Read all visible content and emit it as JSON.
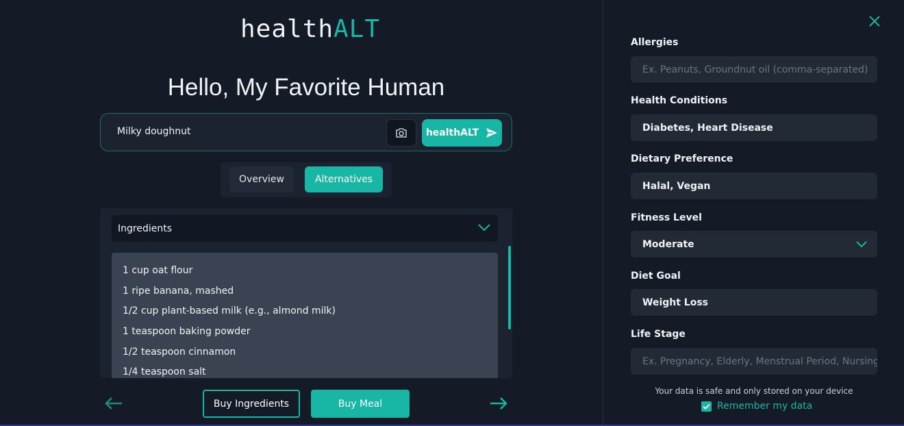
{
  "logo": {
    "prefix": "health",
    "suffix": "ALT"
  },
  "greeting": "Hello, My Favorite Human",
  "search": {
    "value": "Milky doughnut",
    "submit_label": "healthALT"
  },
  "tabs": [
    {
      "label": "Overview",
      "active": false
    },
    {
      "label": "Alternatives",
      "active": true
    }
  ],
  "section_dropdown": {
    "selected": "Ingredients"
  },
  "ingredients": [
    "1 cup oat flour",
    "1 ripe banana, mashed",
    "1/2 cup plant-based milk (e.g., almond milk)",
    "1 teaspoon baking powder",
    "1/2 teaspoon cinnamon",
    "1/4 teaspoon salt"
  ],
  "actions": {
    "buy_ingredients": "Buy Ingredients",
    "buy_meal": "Buy Meal"
  },
  "profile": {
    "allergies": {
      "label": "Allergies",
      "value": "",
      "placeholder": "Ex. Peanuts, Groundnut oil (comma-separated)"
    },
    "health_conditions": {
      "label": "Health Conditions",
      "value": "Diabetes, Heart Disease"
    },
    "dietary_preference": {
      "label": "Dietary Preference",
      "value": "Halal, Vegan"
    },
    "fitness_level": {
      "label": "Fitness Level",
      "value": "Moderate"
    },
    "diet_goal": {
      "label": "Diet Goal",
      "value": "Weight Loss"
    },
    "life_stage": {
      "label": "Life Stage",
      "value": "",
      "placeholder": "Ex. Pregnancy, Elderly, Menstrual Period, Nursing"
    },
    "privacy_note": "Your data is safe and only stored on your device",
    "remember_label": "Remember my data",
    "remember_checked": true
  },
  "colors": {
    "accent": "#17b6a5",
    "background": "#141b27",
    "card": "#1b2330",
    "field": "#222a36"
  },
  "icons": [
    "camera-icon",
    "send-icon",
    "chevron-down-icon",
    "arrow-left-icon",
    "arrow-right-icon",
    "close-icon",
    "checkmark-icon"
  ]
}
